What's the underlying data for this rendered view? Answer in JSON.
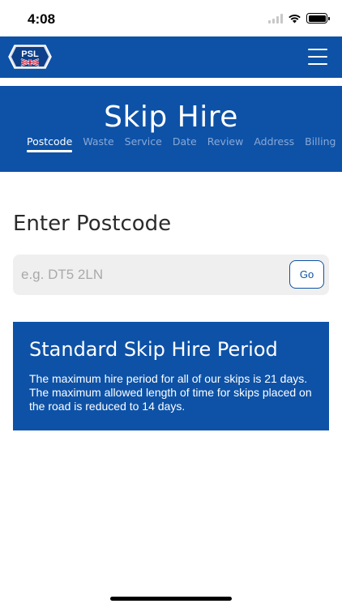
{
  "status_bar": {
    "time": "4:08"
  },
  "header": {
    "logo_text": "PSL",
    "logo_subtext": "PORTLAND SKIPS LTD"
  },
  "hero": {
    "title": "Skip Hire",
    "steps": [
      {
        "label": "Postcode",
        "active": true
      },
      {
        "label": "Waste",
        "active": false
      },
      {
        "label": "Service",
        "active": false
      },
      {
        "label": "Date",
        "active": false
      },
      {
        "label": "Review",
        "active": false
      },
      {
        "label": "Address",
        "active": false
      },
      {
        "label": "Billing",
        "active": false
      }
    ]
  },
  "postcode": {
    "heading": "Enter Postcode",
    "placeholder": "e.g. DT5 2LN",
    "value": "",
    "go_label": "Go"
  },
  "info_card": {
    "title": "Standard Skip Hire Period",
    "text": "The maximum hire period for all of our skips is 21 days. The maximum allowed length of time for skips placed on the road is reduced to 14 days."
  },
  "colors": {
    "brand_blue": "#0d52a7",
    "inactive_step": "#8aa8d6",
    "input_bg": "#efefef"
  }
}
